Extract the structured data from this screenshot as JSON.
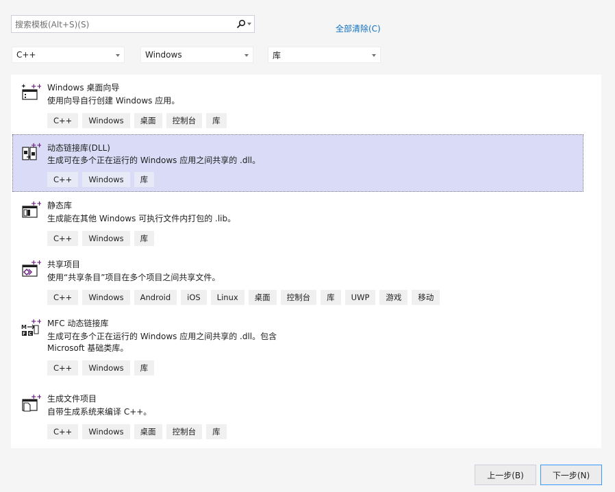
{
  "search": {
    "placeholder": "搜索模板(Alt+S)(S)"
  },
  "clear_all_label": "全部清除(C)",
  "filters": {
    "language": "C++",
    "platform": "Windows",
    "project_type": "库"
  },
  "templates": [
    {
      "title": "Windows 桌面向导",
      "description": [
        "使用向导自行创建 Windows 应用。"
      ],
      "tags": [
        "C++",
        "Windows",
        "桌面",
        "控制台",
        "库"
      ],
      "icon": "wizard-template-icon"
    },
    {
      "title": "动态链接库(DLL)",
      "description": [
        "生成可在多个正在运行的 Windows 应用之间共享的 .dll。"
      ],
      "tags": [
        "C++",
        "Windows",
        "库"
      ],
      "icon": "dll-template-icon",
      "selected": true
    },
    {
      "title": "静态库",
      "description": [
        "生成能在其他 Windows 可执行文件内打包的 .lib。"
      ],
      "tags": [
        "C++",
        "Windows",
        "库"
      ],
      "icon": "static-library-icon"
    },
    {
      "title": "共享项目",
      "description": [
        "使用“共享条目”项目在多个项目之间共享文件。"
      ],
      "tags": [
        "C++",
        "Windows",
        "Android",
        "iOS",
        "Linux",
        "桌面",
        "控制台",
        "库",
        "UWP",
        "游戏",
        "移动"
      ],
      "icon": "shared-project-icon"
    },
    {
      "title": "MFC 动态链接库",
      "description": [
        "生成可在多个正在运行的 Windows 应用之间共享的 .dll。包含",
        "Microsoft 基础类库。"
      ],
      "tags": [
        "C++",
        "Windows",
        "库"
      ],
      "icon": "mfc-dll-icon"
    },
    {
      "title": "生成文件项目",
      "description": [
        "自带生成系统来编译 C++。"
      ],
      "tags": [
        "C++",
        "Windows",
        "桌面",
        "控制台",
        "库"
      ],
      "icon": "makefile-project-icon"
    }
  ],
  "buttons": {
    "back": "上一步(B)",
    "next": "下一步(N)"
  },
  "colors": {
    "accent_purple": "#68217a",
    "selection": "#dadcf7",
    "link": "#0e70c0"
  }
}
